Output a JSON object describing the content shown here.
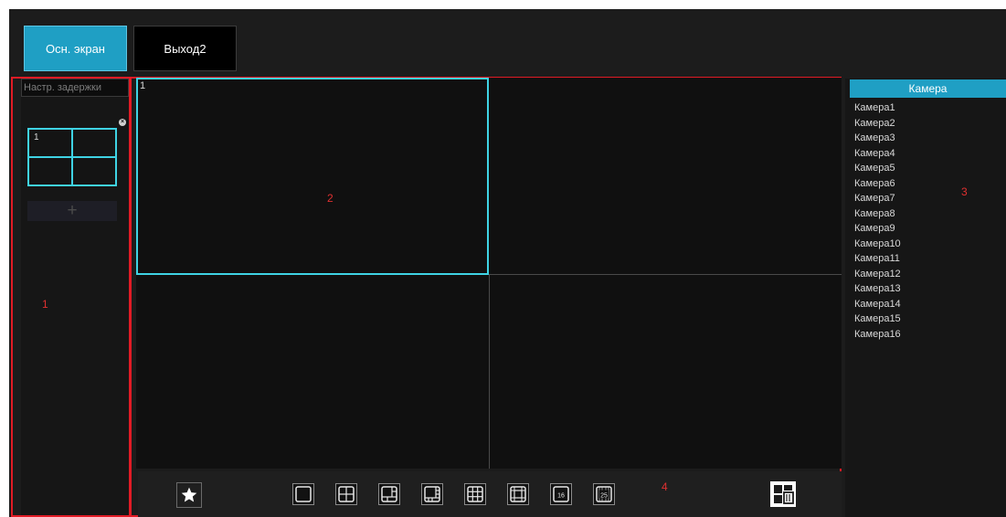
{
  "tabs": [
    {
      "label": "Осн. экран",
      "active": true
    },
    {
      "label": "Выход2",
      "active": false
    }
  ],
  "left_panel": {
    "delay_label": "Настр. задержки",
    "scheme_first_cell_number": "1",
    "add_label": "+"
  },
  "preview": {
    "first_cell_number": "1"
  },
  "camera_list": {
    "header": "Камера",
    "items": [
      "Камера1",
      "Камера2",
      "Камера3",
      "Камера4",
      "Камера5",
      "Камера6",
      "Камера7",
      "Камера8",
      "Камера9",
      "Камера10",
      "Камера11",
      "Камера12",
      "Камера13",
      "Камера14",
      "Камера15",
      "Камера16"
    ]
  },
  "annotations": {
    "n1": "1",
    "n2": "2",
    "n3": "3",
    "n4": "4"
  },
  "toolbar": {
    "icons": [
      "star-icon",
      "layout-1-icon",
      "layout-4-icon",
      "layout-6-icon",
      "layout-8-icon",
      "layout-9-icon",
      "layout-13-icon",
      "layout-16-icon",
      "layout-25-icon",
      "clear-icon"
    ],
    "layout16_text": "16",
    "layout25_text": "25"
  },
  "colors": {
    "accent": "#1f9fc4",
    "cell_border": "#3fd3e4",
    "annotation_red": "#e11b25",
    "background": "#1c1c1c"
  }
}
